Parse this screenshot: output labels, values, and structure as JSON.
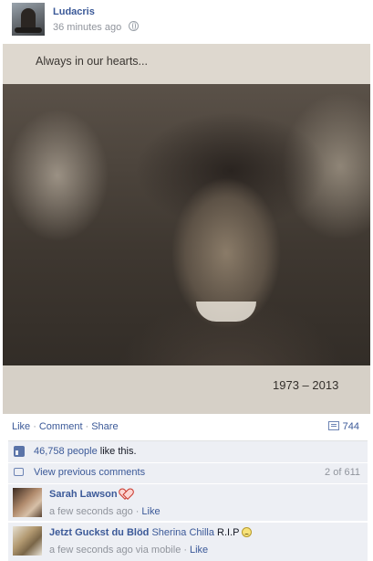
{
  "post": {
    "author": "Ludacris",
    "time": "36 minutes ago",
    "privacy_icon": "globe-icon",
    "photo": {
      "caption": "Always in our hearts...",
      "years": "1973 – 2013"
    }
  },
  "actions": {
    "like": "Like",
    "comment": "Comment",
    "share": "Share",
    "separator": "·",
    "comment_count": "744"
  },
  "likes": {
    "count": "46,758 people",
    "suffix": " like this."
  },
  "previous_comments": {
    "label": "View previous comments",
    "pager": "2 of 611"
  },
  "comments": [
    {
      "name": "Sarah Lawson",
      "body": "",
      "icon": "heart-icon",
      "time": "a few seconds ago",
      "via": "",
      "like": "Like"
    },
    {
      "name": "Jetzt Guckst du Blöd",
      "tag": "Sherina Chilla",
      "body": " R.I.P",
      "icon": "sad-face-icon",
      "time": "a few seconds ago via mobile",
      "like": "Like"
    }
  ],
  "colors": {
    "link": "#3b5998",
    "ufi_background": "#edeff4",
    "meta_text": "#90949c"
  }
}
